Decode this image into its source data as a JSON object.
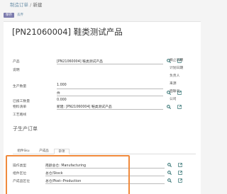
{
  "breadcrumb": {
    "parent": "制造订单",
    "separator": " / ",
    "current": "新建"
  },
  "toolbar": {
    "save_label": "保存",
    "discard_label": "丢弃"
  },
  "form": {
    "title": "[PN21060004] 鞋类测试产品",
    "product_label": "产品",
    "product_value": "[PN21060004] 鞋类测试产品",
    "description_label": "说明",
    "qty_label": "生产数量",
    "qty_value": "1.000",
    "uom_value": "件",
    "done_qty_label": "已报工数量",
    "done_qty_value": "0.000",
    "bom_label": "物料清单",
    "bom_value": "新建: [PN21060004] 鞋类测试产品",
    "routing_label": "工艺路线",
    "right_labels": [
      "概止日期",
      "计划日期",
      "负责人",
      "来源",
      "面联号",
      "公司"
    ]
  },
  "child_section": {
    "title": "子生产订单"
  },
  "tabs": [
    {
      "label": "组件Sku"
    },
    {
      "label": "产成品"
    },
    {
      "label": "杂项"
    }
  ],
  "misc": {
    "operation_type_label": "操作类型",
    "operation_type_value": "南颜总仓: Manufacturing",
    "component_location_label": "组件区位",
    "component_location_value": "总仓/Stock",
    "finished_location_label": "产成品区位",
    "finished_location_value": "总仓/Post--Production"
  },
  "colors": {
    "accent": "#7c7bad",
    "icon_teal": "#2c6e6e",
    "highlight": "#f08a3c"
  }
}
